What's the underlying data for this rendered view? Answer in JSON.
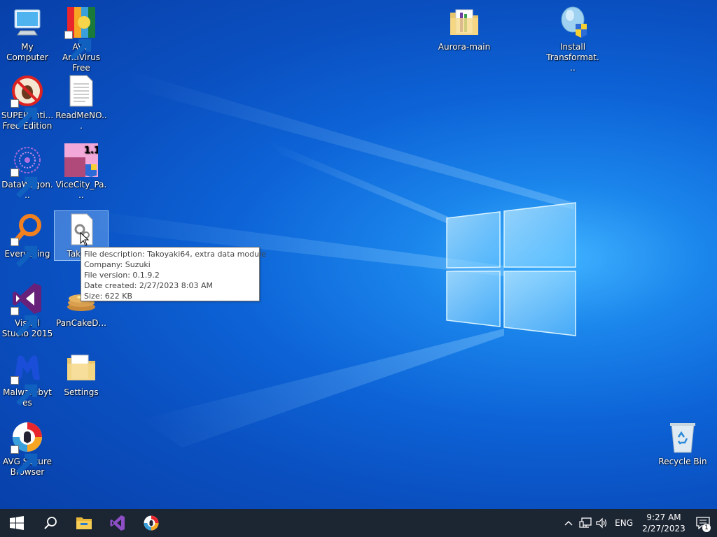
{
  "desktop": {
    "icons": [
      {
        "label": "My Computer",
        "icon": "computer-icon"
      },
      {
        "label": "AVG AntiVirus Free",
        "icon": "avg-antivirus-icon"
      },
      {
        "label": "SUPERAnti... Free Edition",
        "icon": "superantispyware-icon"
      },
      {
        "label": "ReadMeNO...",
        "icon": "text-document-icon"
      },
      {
        "label": "DataWagon...",
        "icon": "datawagon-icon"
      },
      {
        "label": "ViceCity_Pa...",
        "icon": "vicecity-installer-icon",
        "badge": "1.1"
      },
      {
        "label": "Everything",
        "icon": "everything-search-icon"
      },
      {
        "label": "Takoya",
        "icon": "settings-file-icon"
      },
      {
        "label": "Visual Studio 2015",
        "icon": "visual-studio-icon"
      },
      {
        "label": "PanCakeD...",
        "icon": "pancake-icon"
      },
      {
        "label": "Malwarebytes",
        "icon": "malwarebytes-icon"
      },
      {
        "label": "Settings",
        "icon": "folder-icon"
      },
      {
        "label": "AVG Secure Browser",
        "icon": "avg-secure-browser-icon"
      },
      {
        "label": "Aurora-main",
        "icon": "folder-icon"
      },
      {
        "label": "Install Transformat...",
        "icon": "installer-icon"
      },
      {
        "label": "Recycle Bin",
        "icon": "recycle-bin-icon"
      }
    ]
  },
  "tooltip": {
    "description": "File description: Takoyaki64, extra data module",
    "company": "Company: Suzuki",
    "version": "File version: 0.1.9.2",
    "created": "Date created: 2/27/2023 8:03 AM",
    "size": "Size: 622 KB"
  },
  "taskbar": {
    "pinned": [
      "start-icon",
      "search-icon",
      "file-explorer-icon",
      "visual-studio-icon",
      "avg-secure-browser-icon"
    ],
    "language": "ENG",
    "time": "9:27 AM",
    "date": "2/27/2023",
    "notification_count": "1"
  },
  "colors": {
    "taskbar": "#1c2532",
    "wallpaper_accent": "#3fb2ff",
    "tooltip_border": "#777777"
  }
}
